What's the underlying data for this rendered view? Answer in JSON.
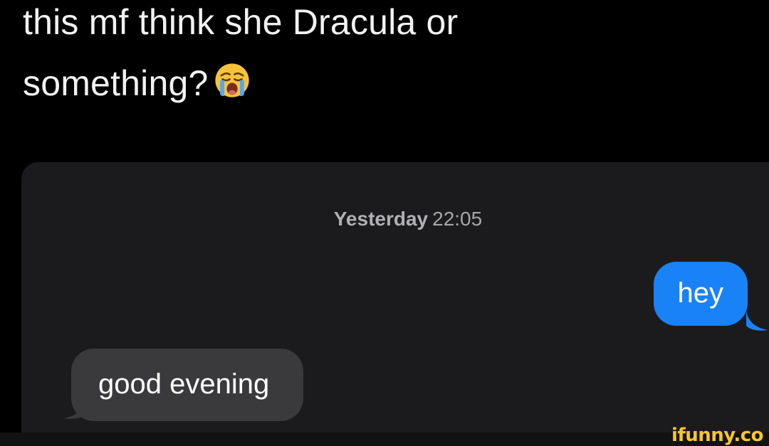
{
  "post": {
    "line1": "this mf think she Dracula or",
    "line2": "something?",
    "emoji": "loudly-crying-face"
  },
  "chat": {
    "timestamp_day": "Yesterday",
    "timestamp_time": "22:05",
    "messages": [
      {
        "direction": "sent",
        "text": "hey",
        "color": "#1a82f7"
      },
      {
        "direction": "received",
        "text": "good evening",
        "color": "#3a3a3c"
      }
    ]
  },
  "watermark": {
    "text": "ifunny.co",
    "color": "#f7c52b"
  }
}
